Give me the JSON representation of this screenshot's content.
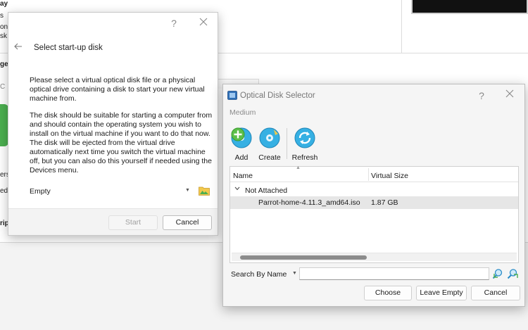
{
  "background": {
    "fragments": [
      "ay",
      "s",
      "on",
      "sk",
      "ge",
      "C",
      "ers",
      "ed",
      "rip"
    ]
  },
  "startup_dialog": {
    "help": "?",
    "title": "Select start-up disk",
    "para1": "Please select a virtual optical disk file or a physical optical drive containing a disk to start your new virtual machine from.",
    "para2": "The disk should be suitable for starting a computer from and should contain the operating system you wish to install on the virtual machine if you want to do that now. The disk will be ejected from the virtual drive automatically next time you switch the virtual machine off, but you can also do this yourself if needed using the Devices menu.",
    "disk_value": "Empty",
    "start_label": "Start",
    "cancel_label": "Cancel"
  },
  "optical_selector": {
    "title": "Optical Disk Selector",
    "help": "?",
    "medium_label": "Medium",
    "toolbar": {
      "add_label": "Add",
      "create_label": "Create",
      "refresh_label": "Refresh"
    },
    "columns": {
      "name": "Name",
      "size": "Virtual Size"
    },
    "group": "Not Attached",
    "item": {
      "name": "Parrot-home-4.11.3_amd64.iso",
      "size": "1.87 GB"
    },
    "search_label": "Search By Name",
    "search_value": "",
    "choose_label": "Choose",
    "leave_empty_label": "Leave Empty",
    "cancel_label": "Cancel"
  },
  "colors": {
    "add_icon": "#4caf50",
    "create_icon": "#29a8e0",
    "refresh_icon": "#29a8e0"
  }
}
